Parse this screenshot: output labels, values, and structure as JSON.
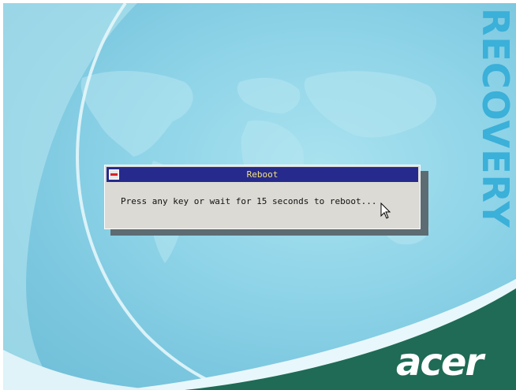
{
  "background": {
    "side_text": "RECOVERY",
    "logo_text": "acer",
    "colors": {
      "sky": "#8fd4e8",
      "map": "#b6e6f1",
      "brand_green": "#1f6b55",
      "recovery_text": "#3bb0d8"
    }
  },
  "dialog": {
    "title": "Reboot",
    "message": "Press any key or wait for 15 seconds to reboot...",
    "close_icon": "minus-close-icon",
    "colors": {
      "titlebar": "#262a8c",
      "title_text": "#f5e27a",
      "body": "#dcdad4"
    }
  },
  "pointer": {
    "icon": "arrow-cursor-icon"
  }
}
